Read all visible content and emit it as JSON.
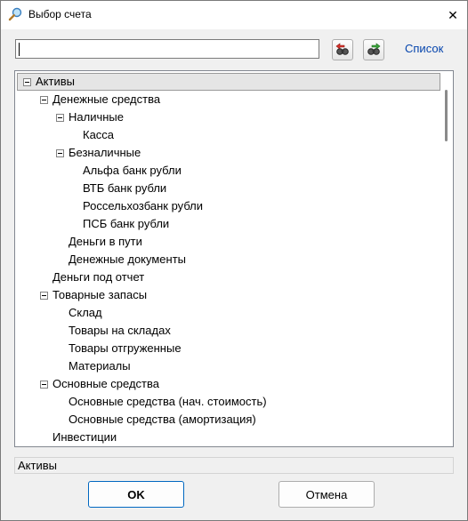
{
  "window": {
    "title": "Выбор счета",
    "close_symbol": "✕"
  },
  "search": {
    "value": "",
    "placeholder": ""
  },
  "toolbar": {
    "link_label": "Список"
  },
  "tree": {
    "rows": [
      {
        "label": "Активы",
        "level": 0,
        "expandable": true,
        "selected": true
      },
      {
        "label": "Денежные средства",
        "level": 1,
        "expandable": true
      },
      {
        "label": "Наличные",
        "level": 2,
        "expandable": true
      },
      {
        "label": "Касса",
        "level": 3,
        "expandable": false
      },
      {
        "label": "Безналичные",
        "level": 2,
        "expandable": true
      },
      {
        "label": "Альфа банк рубли",
        "level": 3,
        "expandable": false
      },
      {
        "label": "ВТБ банк рубли",
        "level": 3,
        "expandable": false
      },
      {
        "label": "Россельхозбанк рубли",
        "level": 3,
        "expandable": false
      },
      {
        "label": "ПСБ банк рубли",
        "level": 3,
        "expandable": false
      },
      {
        "label": "Деньги в пути",
        "level": 2,
        "expandable": false
      },
      {
        "label": "Денежные документы",
        "level": 2,
        "expandable": false
      },
      {
        "label": "Деньги под отчет",
        "level": 1,
        "expandable": false
      },
      {
        "label": "Товарные запасы",
        "level": 1,
        "expandable": true
      },
      {
        "label": "Склад",
        "level": 2,
        "expandable": false
      },
      {
        "label": "Товары на складах",
        "level": 2,
        "expandable": false
      },
      {
        "label": "Товары отгруженные",
        "level": 2,
        "expandable": false
      },
      {
        "label": "Материалы",
        "level": 2,
        "expandable": false
      },
      {
        "label": "Основные средства",
        "level": 1,
        "expandable": true
      },
      {
        "label": "Основные средства (нач. стоимость)",
        "level": 2,
        "expandable": false
      },
      {
        "label": "Основные средства (амортизация)",
        "level": 2,
        "expandable": false
      },
      {
        "label": "Инвестиции",
        "level": 1,
        "expandable": false
      }
    ]
  },
  "status": {
    "text": "Активы"
  },
  "buttons": {
    "ok": "OK",
    "cancel": "Отмена"
  },
  "colors": {
    "link": "#0645ad",
    "default_button_border": "#0067c0",
    "selection": "#e5e5e5"
  }
}
